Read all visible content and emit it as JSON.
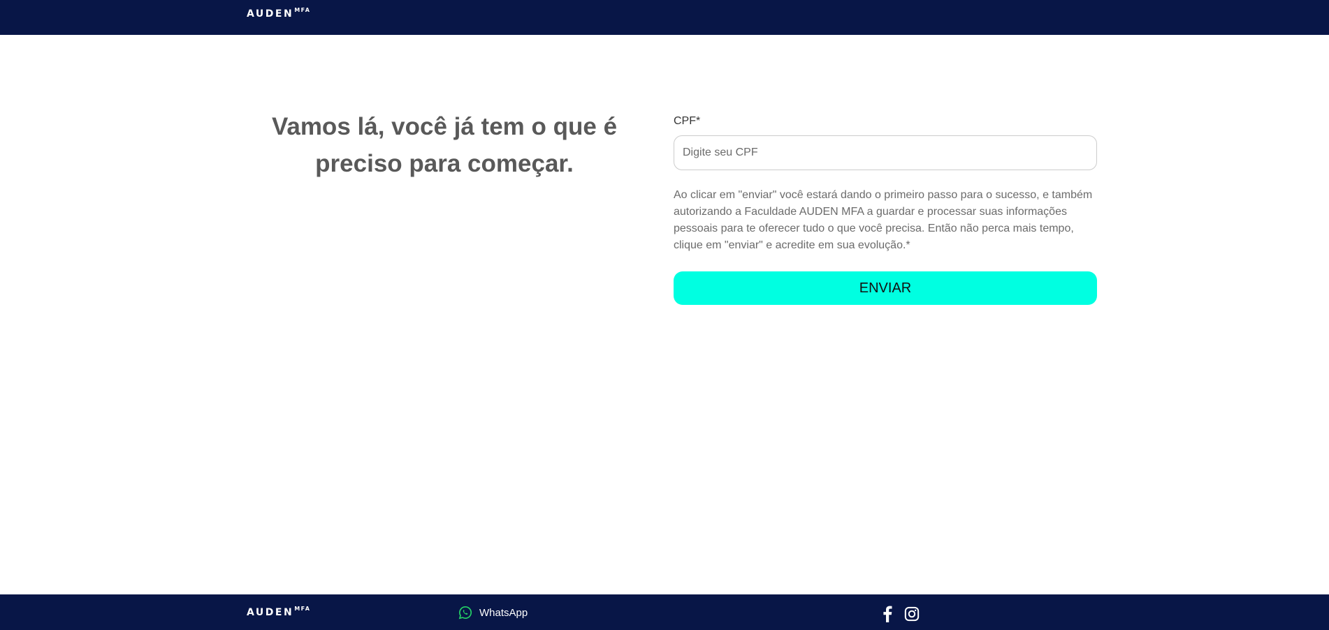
{
  "header": {
    "logo_main": "AUDEN",
    "logo_sup": "MFA"
  },
  "main": {
    "headline": "Vamos lá, você já tem o que é preciso para começar.",
    "form": {
      "cpf_label": "CPF*",
      "cpf_placeholder": "Digite seu CPF",
      "cpf_value": "",
      "consent_text": "Ao clicar em \"enviar\" você estará dando o primeiro passo para o sucesso, e também autorizando a Faculdade AUDEN MFA a guardar e processar suas informações pessoais para te oferecer tudo o que você precisa. Então não perca mais tempo, clique em \"enviar\" e acredite em sua evolução.*",
      "submit_label": "ENVIAR"
    }
  },
  "footer": {
    "logo_main": "AUDEN",
    "logo_sup": "MFA",
    "whatsapp_label": "WhatsApp",
    "whatsapp_icon": "whatsapp-icon",
    "social_icons": [
      "facebook-icon",
      "instagram-icon"
    ]
  },
  "colors": {
    "navy": "#081647",
    "accent": "#00ffe1",
    "whatsapp_green": "#25d366",
    "headline_text": "#595959",
    "body_text": "#6b6b6b"
  }
}
